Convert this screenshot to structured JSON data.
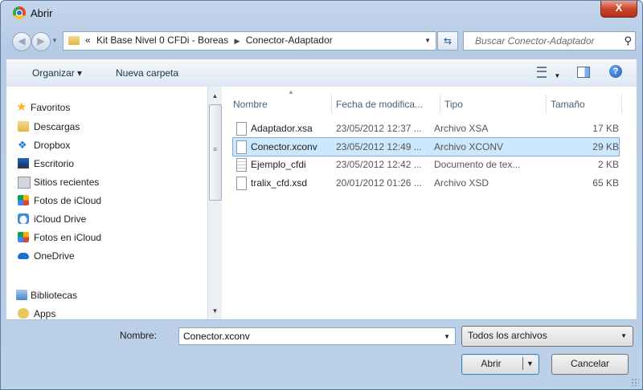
{
  "window": {
    "title": "Abrir",
    "close_label": "X"
  },
  "address": {
    "crumbs": [
      "«",
      "Kit Base Nivel 0 CFDi - Boreas",
      "Conector-Adaptador"
    ],
    "search_placeholder": "Buscar Conector-Adaptador"
  },
  "toolbar": {
    "organize_label": "Organizar ▾",
    "new_folder_label": "Nueva carpeta",
    "help_label": "?"
  },
  "sidebar": {
    "favorites_label": "Favoritos",
    "items": [
      {
        "label": "Descargas",
        "icon": "downloads-icon"
      },
      {
        "label": "Dropbox",
        "icon": "dropbox-icon"
      },
      {
        "label": "Escritorio",
        "icon": "desktop-icon"
      },
      {
        "label": "Sitios recientes",
        "icon": "recent-places-icon"
      },
      {
        "label": "Fotos de iCloud",
        "icon": "icloud-photos-icon"
      },
      {
        "label": "iCloud Drive",
        "icon": "icloud-drive-icon"
      },
      {
        "label": "Fotos en iCloud",
        "icon": "icloud-photos-icon"
      },
      {
        "label": "OneDrive",
        "icon": "onedrive-icon"
      }
    ],
    "libraries_label": "Bibliotecas",
    "apps_label": "Apps"
  },
  "files": {
    "columns": {
      "name": "Nombre",
      "date": "Fecha de modifica...",
      "type": "Tipo",
      "size": "Tamaño"
    },
    "rows": [
      {
        "name": "Adaptador.xsa",
        "date": "23/05/2012 12:37 ...",
        "type": "Archivo XSA",
        "size": "17 KB",
        "selected": false
      },
      {
        "name": "Conector.xconv",
        "date": "23/05/2012 12:49 ...",
        "type": "Archivo XCONV",
        "size": "29 KB",
        "selected": true
      },
      {
        "name": "Ejemplo_cfdi",
        "date": "23/05/2012 12:42 ...",
        "type": "Documento de tex...",
        "size": "2 KB",
        "selected": false
      },
      {
        "name": "tralix_cfd.xsd",
        "date": "20/01/2012 01:26 ...",
        "type": "Archivo XSD",
        "size": "65 KB",
        "selected": false
      }
    ]
  },
  "footer": {
    "name_label": "Nombre:",
    "name_value": "Conector.xconv",
    "filter_value": "Todos los archivos",
    "open_label": "Abrir",
    "cancel_label": "Cancelar"
  },
  "colors": {
    "selection": "#cce8ff",
    "selection_border": "#84acdd",
    "close": "#c9462c"
  }
}
